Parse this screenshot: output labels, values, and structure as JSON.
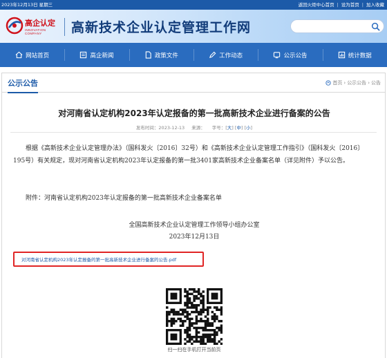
{
  "topbar": {
    "date": "2023年12月13日 星期三",
    "links": [
      "返回火炬中心首页",
      "设为首页",
      "加入收藏"
    ]
  },
  "header": {
    "logo_text": "高企认定",
    "logo_subtext": "INNOVATION COMPANY",
    "title": "高新技术企业认定管理工作网",
    "search_placeholder": ""
  },
  "nav": {
    "items": [
      {
        "label": "网站首页",
        "icon": "home-icon"
      },
      {
        "label": "高企新闻",
        "icon": "news-icon"
      },
      {
        "label": "政策文件",
        "icon": "document-icon"
      },
      {
        "label": "工作动态",
        "icon": "pen-icon"
      },
      {
        "label": "公示公告",
        "icon": "announcement-icon"
      },
      {
        "label": "统计数据",
        "icon": "chart-icon"
      }
    ]
  },
  "section": {
    "title": "公示公告",
    "breadcrumb": [
      "首页",
      "公示公告",
      "公告"
    ]
  },
  "article": {
    "title": "对河南省认定机构2023年认定报备的第一批高新技术企业进行备案的公告",
    "meta_date_label": "发布时间：",
    "meta_date": "2023-12-13",
    "meta_source_label": "来源：",
    "meta_source": "",
    "meta_font_label": "字号：",
    "font_sizes": [
      "大",
      "中",
      "小"
    ],
    "paragraph1": "根据《高新技术企业认定管理办法》（国科发火〔2016〕32号）和《高新技术企业认定管理工作指引》（国科发火〔2016〕195号）有关规定，现对河南省认定机构2023年认定报备的第一批3401家高新技术企业备案名单（详见附件）予以公告。",
    "paragraph2": "附件：河南省认定机构2023年认定报备的第一批高新技术企业备案名单",
    "signature_org": "全国高新技术企业认定管理工作领导小组办公室",
    "signature_date": "2023年12月13日",
    "attachment_link": "对河南省认定机构2023年认定报备的第一批高新技术企业进行备案的公告.pdf",
    "qr_caption": "扫一扫在手机打开当前页"
  },
  "colors": {
    "brand_blue": "#1c5aa8",
    "nav_blue": "#2a6cbf",
    "highlight_red": "#e02424",
    "logo_red": "#d0121b"
  }
}
